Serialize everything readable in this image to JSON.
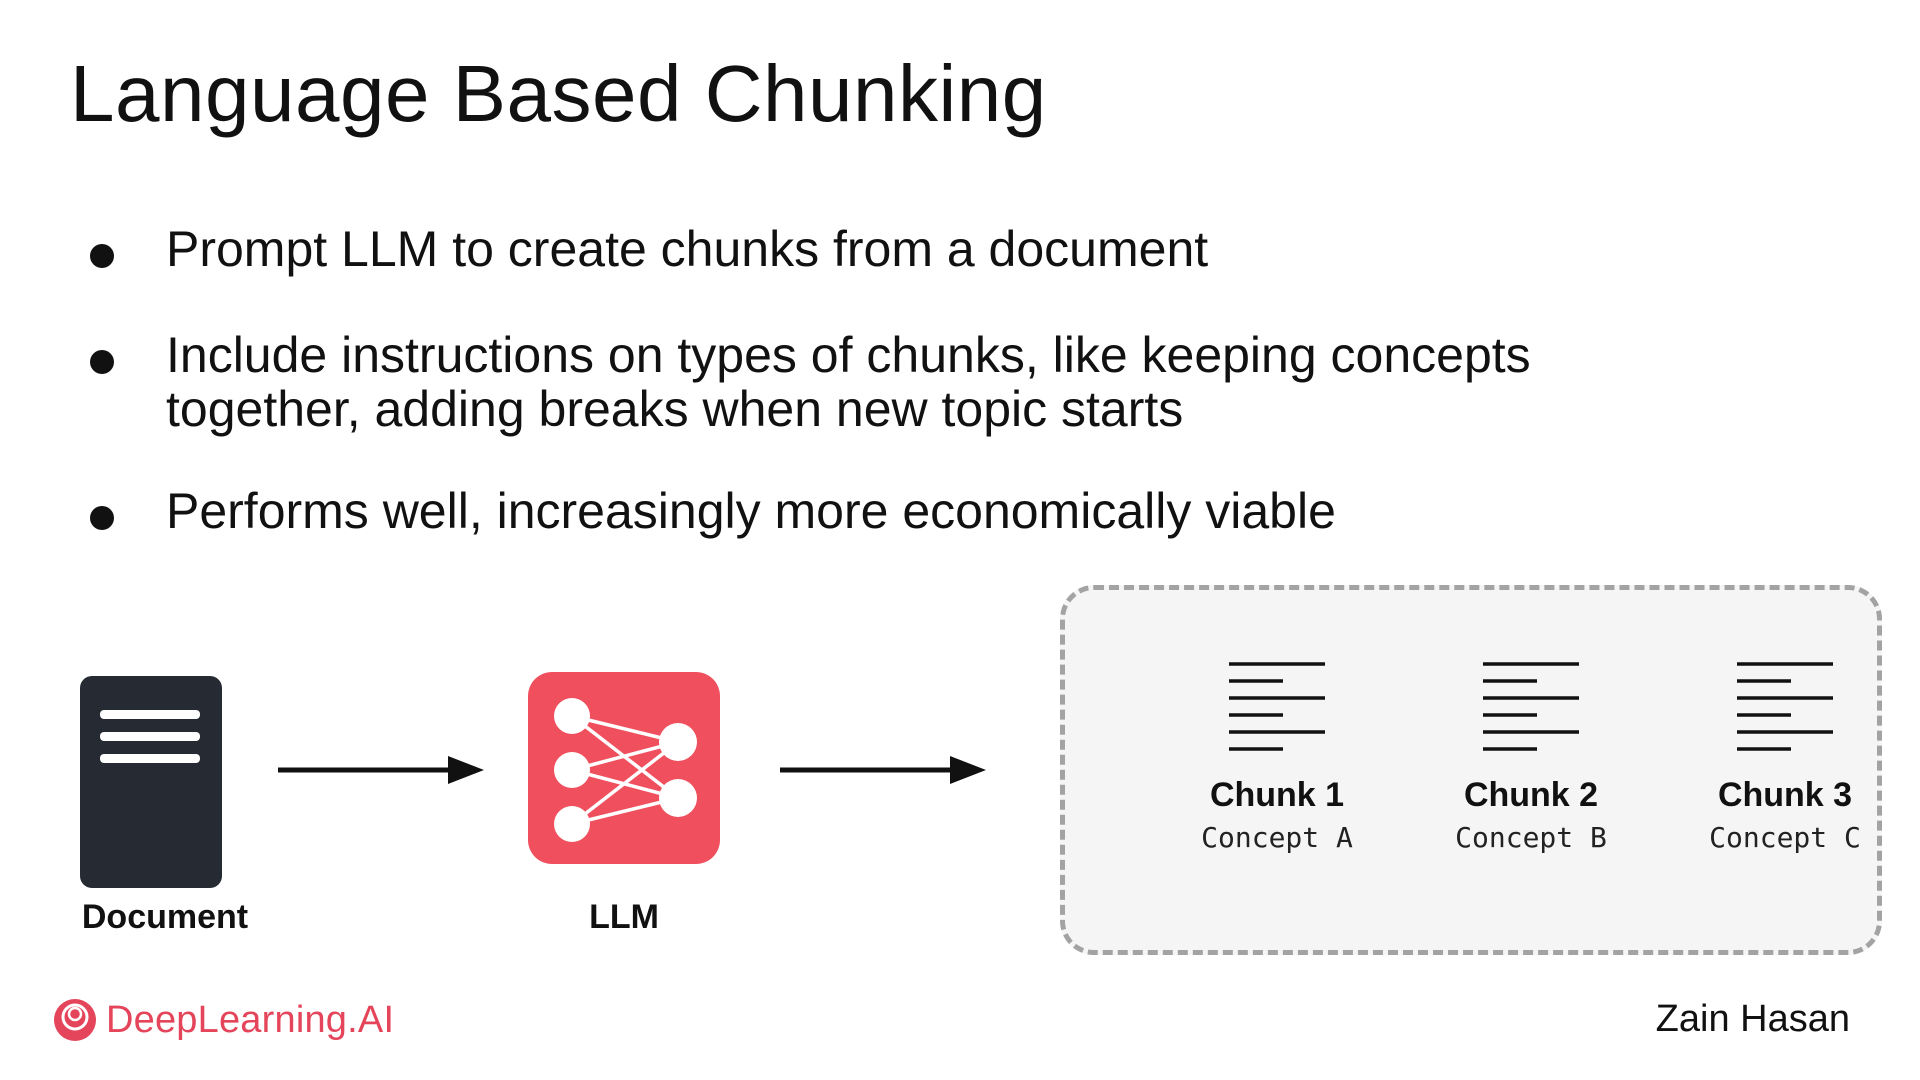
{
  "slide": {
    "title": "Language Based Chunking",
    "bullets": [
      {
        "lines": [
          "Prompt LLM to create chunks from a document"
        ]
      },
      {
        "lines": [
          "Include instructions on types of chunks, like keeping concepts",
          "together, adding breaks when new topic starts"
        ]
      },
      {
        "lines": [
          "Performs well, increasingly more economically viable"
        ]
      }
    ]
  },
  "diagram": {
    "document_label": "Document",
    "llm_label": "LLM",
    "chunks": [
      {
        "name": "Chunk 1",
        "concept": "Concept A"
      },
      {
        "name": "Chunk 2",
        "concept": "Concept B"
      },
      {
        "name": "Chunk 3",
        "concept": "Concept C"
      }
    ]
  },
  "footer": {
    "brand": "DeepLearning.AI",
    "author": "Zain Hasan"
  },
  "colors": {
    "accent": "#f0505e",
    "brand": "#e4455a",
    "doc_icon": "#252a33",
    "chunk_box_bg": "#f5f5f5",
    "chunk_box_border": "#a3a3a3"
  },
  "icons": {
    "document": "document-icon",
    "llm": "neural-network-icon",
    "chunk": "text-lines-icon",
    "brand": "deeplearning-logo-icon"
  }
}
